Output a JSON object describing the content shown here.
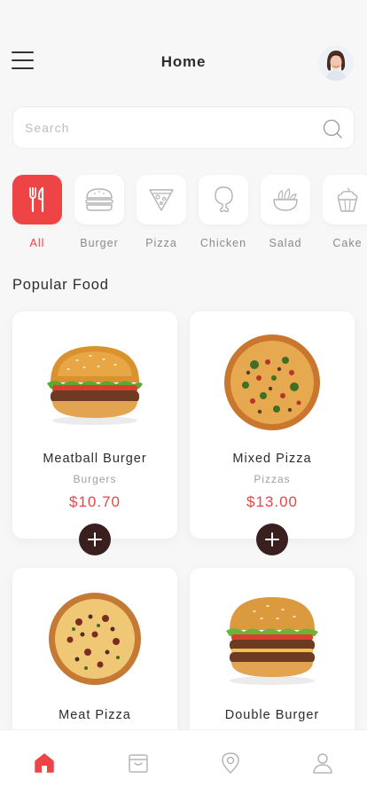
{
  "header": {
    "title": "Home",
    "menu_icon": "hamburger-menu-icon",
    "avatar": "user-avatar"
  },
  "search": {
    "placeholder": "Search",
    "value": "",
    "icon": "search-icon"
  },
  "categories": [
    {
      "label": "All",
      "icon": "utensils-icon",
      "active": true
    },
    {
      "label": "Burger",
      "icon": "burger-icon",
      "active": false
    },
    {
      "label": "Pizza",
      "icon": "pizza-slice-icon",
      "active": false
    },
    {
      "label": "Chicken",
      "icon": "chicken-leg-icon",
      "active": false
    },
    {
      "label": "Salad",
      "icon": "salad-bowl-icon",
      "active": false
    },
    {
      "label": "Cake",
      "icon": "cupcake-icon",
      "active": false
    }
  ],
  "section": {
    "title": "Popular Food"
  },
  "foods": [
    {
      "name": "Meatball Burger",
      "category": "Burgers",
      "price": "$10.70",
      "image": "burger-image"
    },
    {
      "name": "Mixed Pizza",
      "category": "Pizzas",
      "price": "$13.00",
      "image": "pizza-image"
    },
    {
      "name": "Meat Pizza",
      "category": "",
      "price": "",
      "image": "pizza-image"
    },
    {
      "name": "Double Burger",
      "category": "",
      "price": "",
      "image": "burger-image"
    }
  ],
  "bottom_nav": [
    {
      "icon": "home-icon",
      "active": true
    },
    {
      "icon": "archive-icon",
      "active": false
    },
    {
      "icon": "location-pin-icon",
      "active": false
    },
    {
      "icon": "profile-icon",
      "active": false
    }
  ],
  "colors": {
    "accent": "#ef4446",
    "price": "#e64646",
    "add_button": "#3a1f1f",
    "background": "#f7f7f7"
  }
}
